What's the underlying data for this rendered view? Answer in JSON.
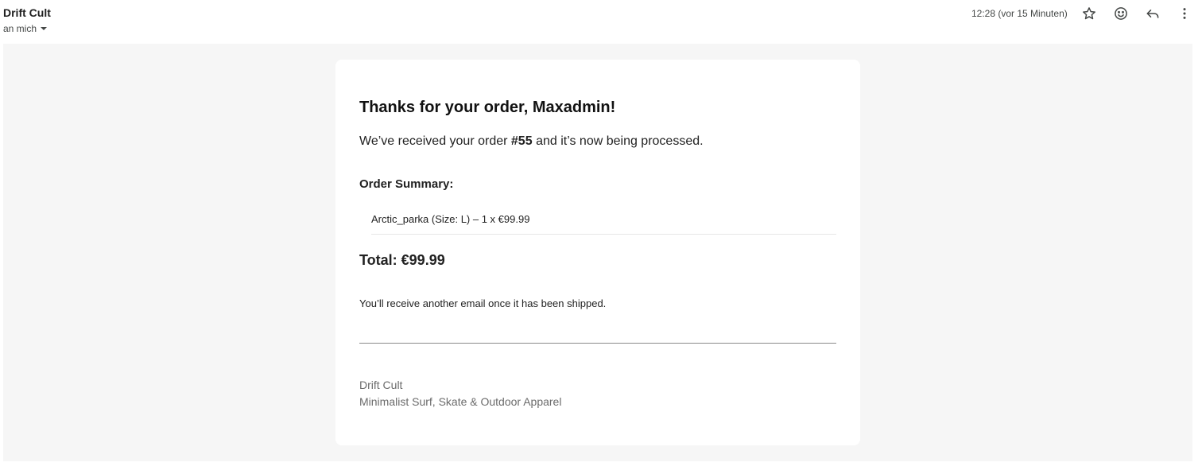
{
  "header": {
    "sender_name": "Drift Cult",
    "recipient_label": "an mich",
    "timestamp": "12:28 (vor 15 Minuten)",
    "icons": [
      "star-icon",
      "emoji-icon",
      "reply-icon",
      "more-vert-icon"
    ]
  },
  "email": {
    "greeting": "Thanks for your order, Maxadmin!",
    "received_prefix": "We’ve received your order",
    "order_number": "#55",
    "received_suffix": "and it’s now being processed.",
    "summary_title": "Order Summary:",
    "items": [
      {
        "text": "Arctic_parka (Size: L) – 1 x €99.99"
      }
    ],
    "total": "Total: €99.99",
    "shipped_note": "You’ll receive another email once it has been shipped.",
    "footer": {
      "company": "Drift Cult",
      "tagline": "Minimalist Surf, Skate & Outdoor Apparel"
    }
  },
  "colors": {
    "email_background": "#f6f6f6",
    "card_background": "#ffffff",
    "footer_text": "#6b6b6b"
  }
}
